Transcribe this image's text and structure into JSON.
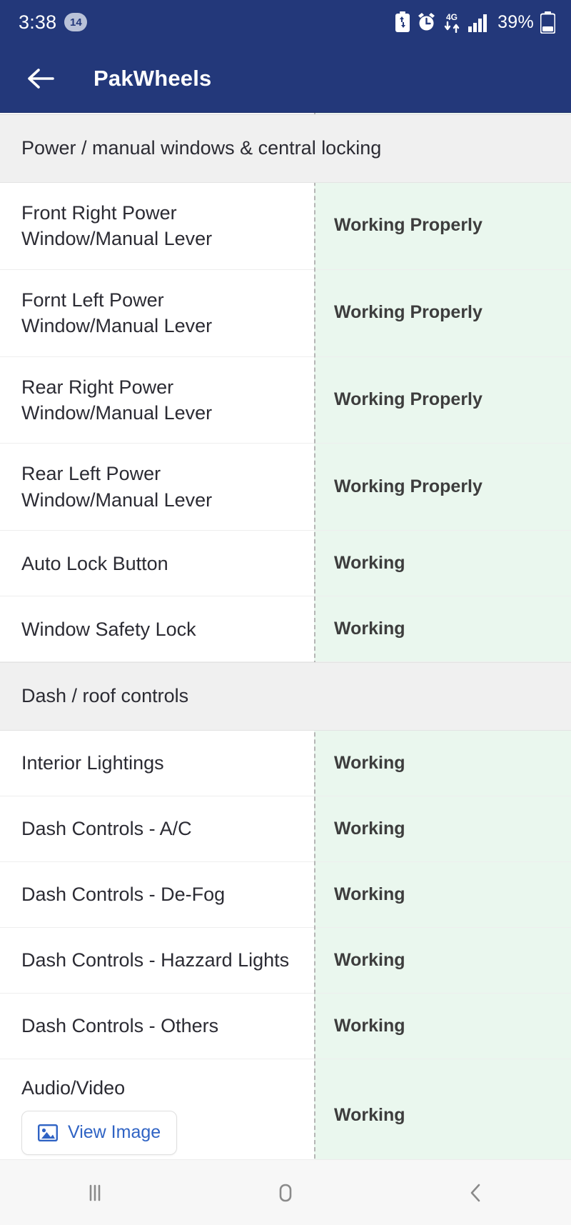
{
  "status_bar": {
    "time": "3:38",
    "notification_count": "14",
    "battery_percent": "39%",
    "icons": [
      "battery-saver-icon",
      "alarm-clock-icon",
      "mobile-data-4g-icon",
      "signal-bars-icon",
      "battery-icon"
    ]
  },
  "app_bar": {
    "back_icon": "back-arrow-icon",
    "title": "PakWheels"
  },
  "inspection": {
    "sections": [
      {
        "title": "Power / manual windows & central locking",
        "rows": [
          {
            "label": "Front Right Power Window/Manual Lever",
            "value": "Working Properly"
          },
          {
            "label": "Fornt Left Power Window/Manual Lever",
            "value": "Working Properly"
          },
          {
            "label": "Rear Right Power Window/Manual Lever",
            "value": "Working Properly"
          },
          {
            "label": "Rear Left Power Window/Manual Lever",
            "value": "Working Properly"
          },
          {
            "label": "Auto Lock Button",
            "value": "Working"
          },
          {
            "label": "Window Safety Lock",
            "value": "Working"
          }
        ]
      },
      {
        "title": "Dash / roof controls",
        "rows": [
          {
            "label": "Interior Lightings",
            "value": "Working"
          },
          {
            "label": "Dash Controls - A/C",
            "value": "Working"
          },
          {
            "label": "Dash Controls - De-Fog",
            "value": "Working"
          },
          {
            "label": "Dash Controls - Hazzard Lights",
            "value": "Working"
          },
          {
            "label": "Dash Controls - Others",
            "value": "Working"
          },
          {
            "label": "Audio/Video",
            "value": "Working",
            "button": "View Image"
          }
        ]
      }
    ]
  },
  "nav_bar": {
    "recents_label": "recents-icon",
    "home_label": "home-icon",
    "back_label": "back-icon"
  },
  "colors": {
    "brand_navy": "#23387a",
    "value_green_bg": "#eaf7ee",
    "section_gray_bg": "#f0f0f0",
    "link_blue": "#2f63c4"
  }
}
